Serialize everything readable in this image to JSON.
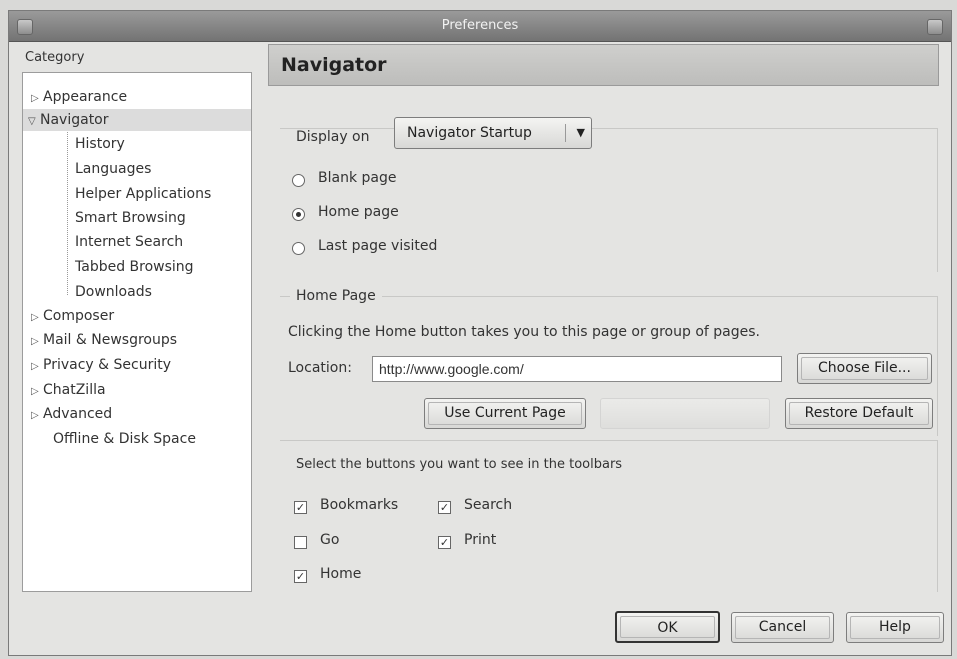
{
  "window": {
    "title": "Preferences"
  },
  "sidebar": {
    "label": "Category",
    "items": [
      {
        "label": "Appearance",
        "arrow": "▷"
      },
      {
        "label": "Navigator",
        "arrow": "▽"
      },
      {
        "label": "History"
      },
      {
        "label": "Languages"
      },
      {
        "label": "Helper Applications"
      },
      {
        "label": "Smart Browsing"
      },
      {
        "label": "Internet Search"
      },
      {
        "label": "Tabbed Browsing"
      },
      {
        "label": "Downloads"
      },
      {
        "label": "Composer",
        "arrow": "▷"
      },
      {
        "label": "Mail & Newsgroups",
        "arrow": "▷"
      },
      {
        "label": "Privacy & Security",
        "arrow": "▷"
      },
      {
        "label": "ChatZilla",
        "arrow": "▷"
      },
      {
        "label": "Advanced",
        "arrow": "▷"
      },
      {
        "label": "Offline & Disk Space"
      }
    ]
  },
  "pane": {
    "title": "Navigator",
    "display_on_label": "Display on",
    "display_on_value": "Navigator Startup",
    "radios": [
      {
        "label": "Blank page",
        "checked": false
      },
      {
        "label": "Home page",
        "checked": true
      },
      {
        "label": "Last page visited",
        "checked": false
      }
    ],
    "home_page": {
      "group_label": "Home Page",
      "description": "Clicking the Home button takes you to this page or group of pages.",
      "location_label": "Location:",
      "location_value": "http://www.google.com/",
      "choose_file": "Choose File...",
      "use_current": "Use Current Page",
      "restore_default": "Restore Default"
    },
    "toolbar": {
      "description": "Select the buttons you want to see in the toolbars",
      "checkboxes": [
        {
          "label": "Bookmarks",
          "checked": true
        },
        {
          "label": "Search",
          "checked": true
        },
        {
          "label": "Go",
          "checked": false
        },
        {
          "label": "Print",
          "checked": true
        },
        {
          "label": "Home",
          "checked": true
        }
      ]
    }
  },
  "buttons": {
    "ok": "OK",
    "cancel": "Cancel",
    "help": "Help"
  },
  "icons": {
    "check": "✓",
    "dropdown": "▼"
  }
}
